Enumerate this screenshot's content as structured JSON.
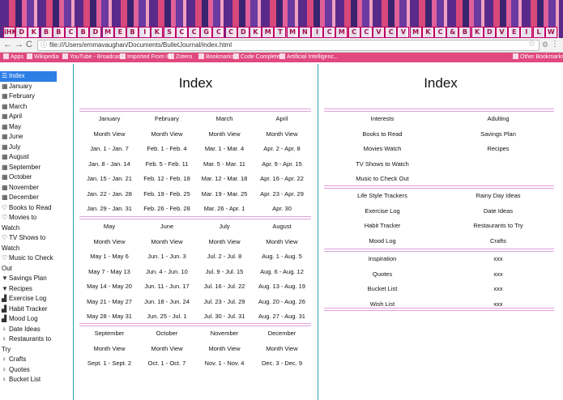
{
  "tab_icons": [
    "iHK",
    "D",
    "K",
    "B",
    "B",
    "C",
    "B",
    "D",
    "M",
    "E",
    "B",
    "I",
    "K",
    "S",
    "C",
    "C",
    "G",
    "C",
    "C",
    "D",
    "K",
    "M",
    "T",
    "M",
    "N",
    "I",
    "C",
    "M",
    "C",
    "C",
    "V",
    "C",
    "V",
    "M",
    "K",
    "C",
    "&",
    "B",
    "K",
    "D",
    "V",
    "E",
    "I",
    "L",
    "W"
  ],
  "toolbar": {
    "back": "←",
    "forward": "→",
    "reload": "C",
    "url": "file:///Users/emmavaughan/Documents/BulletJournal/index.html",
    "info_icon": "ⓘ",
    "star": "☆",
    "ext": "⚙",
    "menu": "⋮"
  },
  "bookmarks": [
    {
      "label": "Apps"
    },
    {
      "label": "Wikipedia"
    },
    {
      "label": "YouTube - Broadcas..."
    },
    {
      "label": "Imported From IE"
    },
    {
      "label": "Zotero"
    },
    {
      "label": "Bookmarks"
    },
    {
      "label": "Code Complete"
    },
    {
      "label": "Artificial Intelligenc..."
    },
    {
      "label": "Other Bookmarks"
    }
  ],
  "sidebar": {
    "items": [
      {
        "icon": "☰",
        "label": "Index",
        "active": true
      },
      {
        "icon": "▦",
        "label": "January"
      },
      {
        "icon": "▦",
        "label": "February"
      },
      {
        "icon": "▦",
        "label": "March"
      },
      {
        "icon": "▦",
        "label": "April"
      },
      {
        "icon": "▦",
        "label": "May"
      },
      {
        "icon": "▦",
        "label": "June"
      },
      {
        "icon": "▦",
        "label": "July"
      },
      {
        "icon": "▦",
        "label": "August"
      },
      {
        "icon": "▦",
        "label": "September"
      },
      {
        "icon": "▦",
        "label": "October"
      },
      {
        "icon": "▦",
        "label": "November"
      },
      {
        "icon": "▦",
        "label": "December"
      },
      {
        "icon": "♡",
        "label": "Books to Read"
      },
      {
        "icon": "♡",
        "label": "Movies to Watch"
      },
      {
        "icon": "♡",
        "label": "TV Shows to Watch"
      },
      {
        "icon": "♡",
        "label": "Music to Check Out"
      },
      {
        "icon": "▼",
        "label": "Savings Plan"
      },
      {
        "icon": "▼",
        "label": "Recipes"
      },
      {
        "icon": "▟",
        "label": "Exercise Log"
      },
      {
        "icon": "▟",
        "label": "Habit Tracker"
      },
      {
        "icon": "▟",
        "label": "Mood Log"
      },
      {
        "icon": "♀",
        "label": "Date Ideas"
      },
      {
        "icon": "♀",
        "label": "Restaurants to Try"
      },
      {
        "icon": "♀",
        "label": "Crafts"
      },
      {
        "icon": "♀",
        "label": "Quotes"
      },
      {
        "icon": "♀",
        "label": "Bucket List"
      }
    ]
  },
  "left_panel": {
    "title": "Index",
    "blocks": [
      {
        "columns": [
          {
            "month": "January",
            "view": "Month View",
            "weeks": [
              "Jan. 1 - Jan. 7",
              "Jan. 8 - Jan. 14",
              "Jan. 15 - Jan. 21",
              "Jan. 22 - Jan. 28",
              "Jan. 29 - Jan. 31"
            ]
          },
          {
            "month": "February",
            "view": "Month View",
            "weeks": [
              "Feb. 1 - Feb. 4",
              "Feb. 5 - Feb. 11",
              "Feb. 12 - Feb. 18",
              "Feb. 19 - Feb. 25",
              "Feb. 26 - Feb. 28"
            ]
          },
          {
            "month": "March",
            "view": "Month View",
            "weeks": [
              "Mar. 1 - Mar. 4",
              "Mar. 5 - Mar. 11",
              "Mar. 12 - Mar. 18",
              "Mar. 19 - Mar. 25",
              "Mar. 26 - Apr. 1"
            ]
          },
          {
            "month": "April",
            "view": "Month View",
            "weeks": [
              "Apr. 2 - Apr. 8",
              "Apr. 9 - Apr. 15",
              "Apr. 16 - Apr. 22",
              "Apr. 23 - Apr. 29",
              "Apr. 30"
            ]
          }
        ]
      },
      {
        "columns": [
          {
            "month": "May",
            "view": "Month View",
            "weeks": [
              "May 1 - May 6",
              "May 7 - May 13",
              "May 14 - May 20",
              "May 21 - May 27",
              "May 28 - May 31"
            ]
          },
          {
            "month": "June",
            "view": "Month View",
            "weeks": [
              "Jun. 1 - Jun. 3",
              "Jun. 4 - Jun. 10",
              "Jun. 11 - Jun. 17",
              "Jun. 18 - Jun. 24",
              "Jun. 25 - Jul. 1"
            ]
          },
          {
            "month": "July",
            "view": "Month View",
            "weeks": [
              "Jul. 2 - Jul. 8",
              "Jul. 9 - Jul. 15",
              "Jul. 16 - Jul. 22",
              "Jul. 23 - Jul. 29",
              "Jul. 30 - Jul. 31"
            ]
          },
          {
            "month": "August",
            "view": "Month View",
            "weeks": [
              "Aug. 1 - Aug. 5",
              "Aug. 6 - Aug. 12",
              "Aug. 13 - Aug. 19",
              "Aug. 20 - Aug. 26",
              "Aug. 27 - Aug. 31"
            ]
          }
        ]
      },
      {
        "columns": [
          {
            "month": "September",
            "view": "Month View",
            "weeks": [
              "Sept. 1 - Sept. 2"
            ]
          },
          {
            "month": "October",
            "view": "Month View",
            "weeks": [
              "Oct. 1 - Oct. 7"
            ]
          },
          {
            "month": "November",
            "view": "Month View",
            "weeks": [
              "Nov. 1 - Nov. 4"
            ]
          },
          {
            "month": "December",
            "view": "Month View",
            "weeks": [
              "Dec. 3 - Dec. 9"
            ]
          }
        ]
      }
    ]
  },
  "right_panel": {
    "title": "Index",
    "groups": [
      {
        "left": [
          "Interests",
          "Books to Read",
          "Movies Watch",
          "TV Shows to Watch",
          "Music to Check Out"
        ],
        "right": [
          "Adulting",
          "Savings Plan",
          "Recipes",
          "",
          ""
        ]
      },
      {
        "left": [
          "Life Style Trackers",
          "Exercise Log",
          "Habit Tracker",
          "Mood Log"
        ],
        "right": [
          "Rainy Day Ideas",
          "Date Ideas",
          "Restaurants to Try",
          "Crafts"
        ]
      },
      {
        "left": [
          "Inspiration",
          "Quotes",
          "Bucket List",
          "Wish List"
        ],
        "right": [
          "xxx",
          "xxx",
          "xxx",
          "xxx"
        ]
      }
    ]
  },
  "colors": {
    "accent_blue": "#2d7fe6",
    "divider_pink": "#e0a0e0",
    "bookmark_bar": "#e0487e",
    "panel_border": "#2ba3b8"
  }
}
